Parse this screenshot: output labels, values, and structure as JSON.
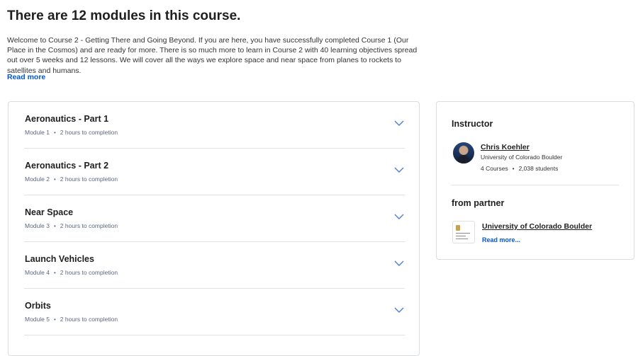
{
  "header": {
    "title": "There are 12 modules in this course.",
    "description": "Welcome to Course 2 - Getting There and Going Beyond. If you are here, you have successfully completed Course 1 (Our Place in the Cosmos) and are ready for more. There is so much more to learn in Course 2 with 40 learning objectives spread out over 5 weeks and 12 lessons. We will cover all the ways we explore space and near space from planes to rockets to satellites and humans.",
    "read_more": "Read more"
  },
  "modules": [
    {
      "title": "Aeronautics - Part 1",
      "number": "Module 1",
      "duration": "2 hours to completion"
    },
    {
      "title": "Aeronautics - Part 2",
      "number": "Module 2",
      "duration": "2 hours to completion"
    },
    {
      "title": "Near Space",
      "number": "Module 3",
      "duration": "2 hours to completion"
    },
    {
      "title": "Launch Vehicles",
      "number": "Module 4",
      "duration": "2 hours to completion"
    },
    {
      "title": "Orbits",
      "number": "Module 5",
      "duration": "2 hours to completion"
    }
  ],
  "sidebar": {
    "instructor_heading": "Instructor",
    "instructor": {
      "name": "Chris Koehler",
      "org": "University of Colorado Boulder",
      "courses": "4 Courses",
      "students": "2,038 students"
    },
    "partner_heading": "from partner",
    "partner": {
      "name": "University of Colorado Boulder",
      "read_more": "Read more...",
      "logo_text": "University of Colorado Boulder"
    }
  },
  "colors": {
    "link": "#0056d2",
    "chevron": "#4c7ed8",
    "border": "#dadce0"
  },
  "icons": {
    "module_toggle": "chevron-down-icon",
    "instructor_avatar": "avatar",
    "partner_logo": "university-logo"
  }
}
